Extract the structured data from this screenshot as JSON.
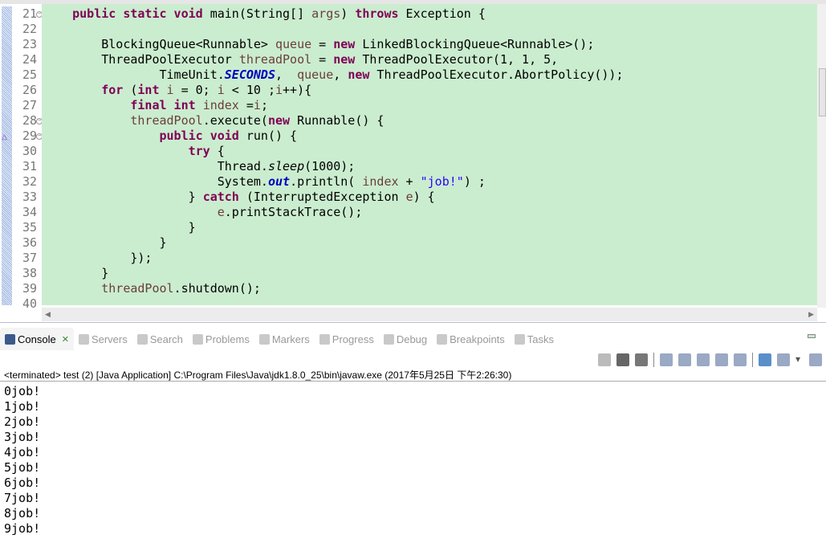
{
  "editor": {
    "lines": [
      {
        "n": "21",
        "fold": true,
        "seg": [
          [
            "p",
            "    "
          ],
          [
            "k",
            "public static void"
          ],
          [
            "p",
            " main(String[] "
          ],
          [
            "v",
            "args"
          ],
          [
            "p",
            ") "
          ],
          [
            "k",
            "throws"
          ],
          [
            "p",
            " Exception {"
          ]
        ]
      },
      {
        "n": "22",
        "seg": []
      },
      {
        "n": "23",
        "seg": [
          [
            "p",
            "        BlockingQueue<Runnable> "
          ],
          [
            "v",
            "queue"
          ],
          [
            "p",
            " = "
          ],
          [
            "k",
            "new"
          ],
          [
            "p",
            " LinkedBlockingQueue<Runnable>();"
          ]
        ]
      },
      {
        "n": "24",
        "seg": [
          [
            "p",
            "        ThreadPoolExecutor "
          ],
          [
            "v",
            "threadPool"
          ],
          [
            "p",
            " = "
          ],
          [
            "k",
            "new"
          ],
          [
            "p",
            " ThreadPoolExecutor(1, 1, 5,"
          ]
        ]
      },
      {
        "n": "25",
        "seg": [
          [
            "p",
            "                TimeUnit."
          ],
          [
            "f",
            "SECONDS"
          ],
          [
            "p",
            ",  "
          ],
          [
            "v",
            "queue"
          ],
          [
            "p",
            ", "
          ],
          [
            "k",
            "new"
          ],
          [
            "p",
            " ThreadPoolExecutor.AbortPolicy());"
          ]
        ]
      },
      {
        "n": "26",
        "seg": [
          [
            "p",
            "        "
          ],
          [
            "k",
            "for"
          ],
          [
            "p",
            " ("
          ],
          [
            "k",
            "int"
          ],
          [
            "p",
            " "
          ],
          [
            "v",
            "i"
          ],
          [
            "p",
            " = 0; "
          ],
          [
            "v",
            "i"
          ],
          [
            "p",
            " < 10 ;"
          ],
          [
            "v",
            "i"
          ],
          [
            "p",
            "++){"
          ]
        ]
      },
      {
        "n": "27",
        "seg": [
          [
            "p",
            "            "
          ],
          [
            "k",
            "final int"
          ],
          [
            "p",
            " "
          ],
          [
            "v",
            "index"
          ],
          [
            "p",
            " ="
          ],
          [
            "v",
            "i"
          ],
          [
            "p",
            ";"
          ]
        ]
      },
      {
        "n": "28",
        "fold": true,
        "seg": [
          [
            "p",
            "            "
          ],
          [
            "v",
            "threadPool"
          ],
          [
            "p",
            ".execute("
          ],
          [
            "k",
            "new"
          ],
          [
            "p",
            " Runnable() {"
          ]
        ]
      },
      {
        "n": "29",
        "fold": true,
        "override": true,
        "seg": [
          [
            "p",
            "                "
          ],
          [
            "k",
            "public void"
          ],
          [
            "p",
            " run() {"
          ]
        ]
      },
      {
        "n": "30",
        "seg": [
          [
            "p",
            "                    "
          ],
          [
            "k",
            "try"
          ],
          [
            "p",
            " {"
          ]
        ]
      },
      {
        "n": "31",
        "seg": [
          [
            "p",
            "                        Thread."
          ],
          [
            "i",
            "sleep"
          ],
          [
            "p",
            "(1000);"
          ]
        ]
      },
      {
        "n": "32",
        "seg": [
          [
            "p",
            "                        System."
          ],
          [
            "f",
            "out"
          ],
          [
            "p",
            ".println( "
          ],
          [
            "v",
            "index"
          ],
          [
            "p",
            " + "
          ],
          [
            "s",
            "\"job!\""
          ],
          [
            "p",
            ") ;"
          ]
        ]
      },
      {
        "n": "33",
        "seg": [
          [
            "p",
            "                    } "
          ],
          [
            "k",
            "catch"
          ],
          [
            "p",
            " (InterruptedException "
          ],
          [
            "v",
            "e"
          ],
          [
            "p",
            ") {"
          ]
        ]
      },
      {
        "n": "34",
        "seg": [
          [
            "p",
            "                        "
          ],
          [
            "v",
            "e"
          ],
          [
            "p",
            ".printStackTrace();"
          ]
        ]
      },
      {
        "n": "35",
        "seg": [
          [
            "p",
            "                    }"
          ]
        ]
      },
      {
        "n": "36",
        "seg": [
          [
            "p",
            "                }"
          ]
        ]
      },
      {
        "n": "37",
        "seg": [
          [
            "p",
            "            });"
          ]
        ]
      },
      {
        "n": "38",
        "seg": [
          [
            "p",
            "        }"
          ]
        ]
      },
      {
        "n": "39",
        "seg": [
          [
            "p",
            "        "
          ],
          [
            "v",
            "threadPool"
          ],
          [
            "p",
            ".shutdown();"
          ]
        ]
      },
      {
        "n": "40",
        "seg": []
      }
    ]
  },
  "console": {
    "tabs": [
      {
        "label": "Console",
        "icon": "console-icon",
        "active": true
      },
      {
        "label": "Servers",
        "icon": "servers-icon"
      },
      {
        "label": "Search",
        "icon": "search-icon"
      },
      {
        "label": "Problems",
        "icon": "problems-icon"
      },
      {
        "label": "Markers",
        "icon": "markers-icon"
      },
      {
        "label": "Progress",
        "icon": "progress-icon"
      },
      {
        "label": "Debug",
        "icon": "debug-icon"
      },
      {
        "label": "Breakpoints",
        "icon": "breakpoints-icon"
      },
      {
        "label": "Tasks",
        "icon": "tasks-icon"
      }
    ],
    "toolbar": [
      "terminate-icon",
      "remove-launch-icon",
      "remove-all-terminated-icon",
      "|",
      "clear-console-icon",
      "scroll-lock-icon",
      "word-wrap-icon",
      "show-on-stdout-icon",
      "show-on-stderr-icon",
      "|",
      "pin-console-icon",
      "display-console-icon",
      "dropdown-icon",
      "open-console-icon"
    ],
    "status": "<terminated> test (2) [Java Application] C:\\Program Files\\Java\\jdk1.8.0_25\\bin\\javaw.exe (2017年5月25日 下午2:26:30)",
    "output": [
      "0job!",
      "1job!",
      "2job!",
      "3job!",
      "4job!",
      "5job!",
      "6job!",
      "7job!",
      "8job!",
      "9job!"
    ]
  }
}
